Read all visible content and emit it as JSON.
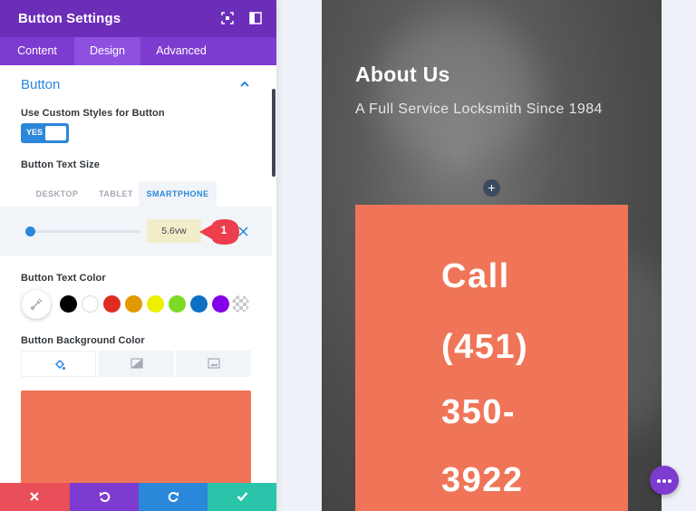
{
  "panel": {
    "title": "Button Settings",
    "tabs": [
      {
        "label": "Content"
      },
      {
        "label": "Design"
      },
      {
        "label": "Advanced"
      }
    ],
    "active_tab": "Design"
  },
  "section": {
    "title": "Button",
    "custom_styles_label": "Use Custom Styles for Button",
    "toggle_value": "YES",
    "text_size_label": "Button Text Size",
    "device_tabs": [
      {
        "label": "DESKTOP"
      },
      {
        "label": "TABLET"
      },
      {
        "label": "SMARTPHONE"
      }
    ],
    "active_device": "SMARTPHONE",
    "text_size_value": "5.6vw",
    "slider_fraction": 0.03,
    "marker_number": "1",
    "text_color_label": "Button Text Color",
    "text_color_swatches": [
      "#000000",
      "#ffffff",
      "#e02b20",
      "#e09900",
      "#edf000",
      "#7cda24",
      "#0c71c3",
      "#8300e9"
    ],
    "bg_color_label": "Button Background Color",
    "bg_color": "#f07558"
  },
  "actions": {
    "cancel": "close-icon",
    "undo": "undo-icon",
    "redo": "redo-icon",
    "save": "check-icon"
  },
  "preview": {
    "heading": "About Us",
    "subheading": "A Full Service Locksmith Since 1984",
    "add_row": "+",
    "cta_lines": [
      "Call",
      "(451)",
      "350-",
      "3922"
    ],
    "cta_color": "#f07558"
  },
  "colors": {
    "header": "#6c2eb9",
    "tabs": "#7e3bd0",
    "accent_blue": "#2b87da",
    "marker_red": "#ec3e4d",
    "save_green": "#29c4a9"
  }
}
